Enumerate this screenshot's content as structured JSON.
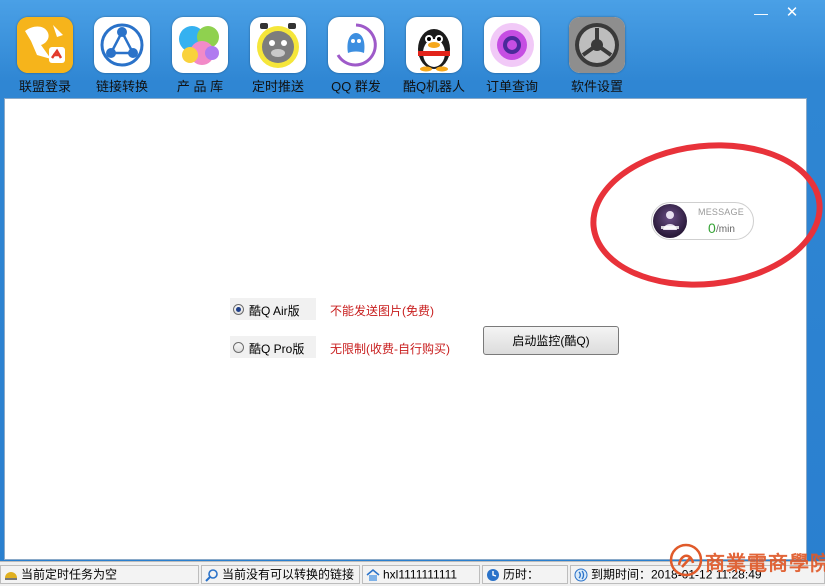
{
  "window": {
    "min_glyph": "—",
    "close_glyph": "✕"
  },
  "toolbar": {
    "items": [
      {
        "label": "联盟登录",
        "icon": "kangaroo-logo-icon"
      },
      {
        "label": "链接转换",
        "icon": "share-link-icon"
      },
      {
        "label": "产 品 库",
        "icon": "bubbles-icon"
      },
      {
        "label": "定时推送",
        "icon": "alarm-clock-icon"
      },
      {
        "label": "QQ 群发",
        "icon": "qq-chat-icon"
      },
      {
        "label": "酷Q机器人",
        "icon": "qq-penguin-icon"
      },
      {
        "label": "订单查询",
        "icon": "purple-circle-icon"
      },
      {
        "label": "软件设置",
        "icon": "settings-dial-icon"
      }
    ]
  },
  "options": [
    {
      "label": "酷Q Air版",
      "note": "不能发送图片(免费)",
      "selected": true
    },
    {
      "label": "酷Q Pro版",
      "note": "无限制(收费-自行购买)",
      "selected": false
    }
  ],
  "start_button": "启动监控(酷Q)",
  "message_widget": {
    "title": "MESSAGE",
    "count": "0",
    "unit": "/min"
  },
  "status": {
    "task": "当前定时任务为空",
    "link": "当前没有可以转换的链接",
    "user": "hxl1111111111",
    "elapsed_label": "历时：",
    "expire_label": "到期时间：2018-01-12 11:28:49"
  },
  "watermark": "商業電商學院",
  "colors": {
    "note_red": "#c81e1e",
    "frame_blue": "#2f86d3",
    "ring_red": "#e8323a",
    "count_green": "#37a437"
  }
}
